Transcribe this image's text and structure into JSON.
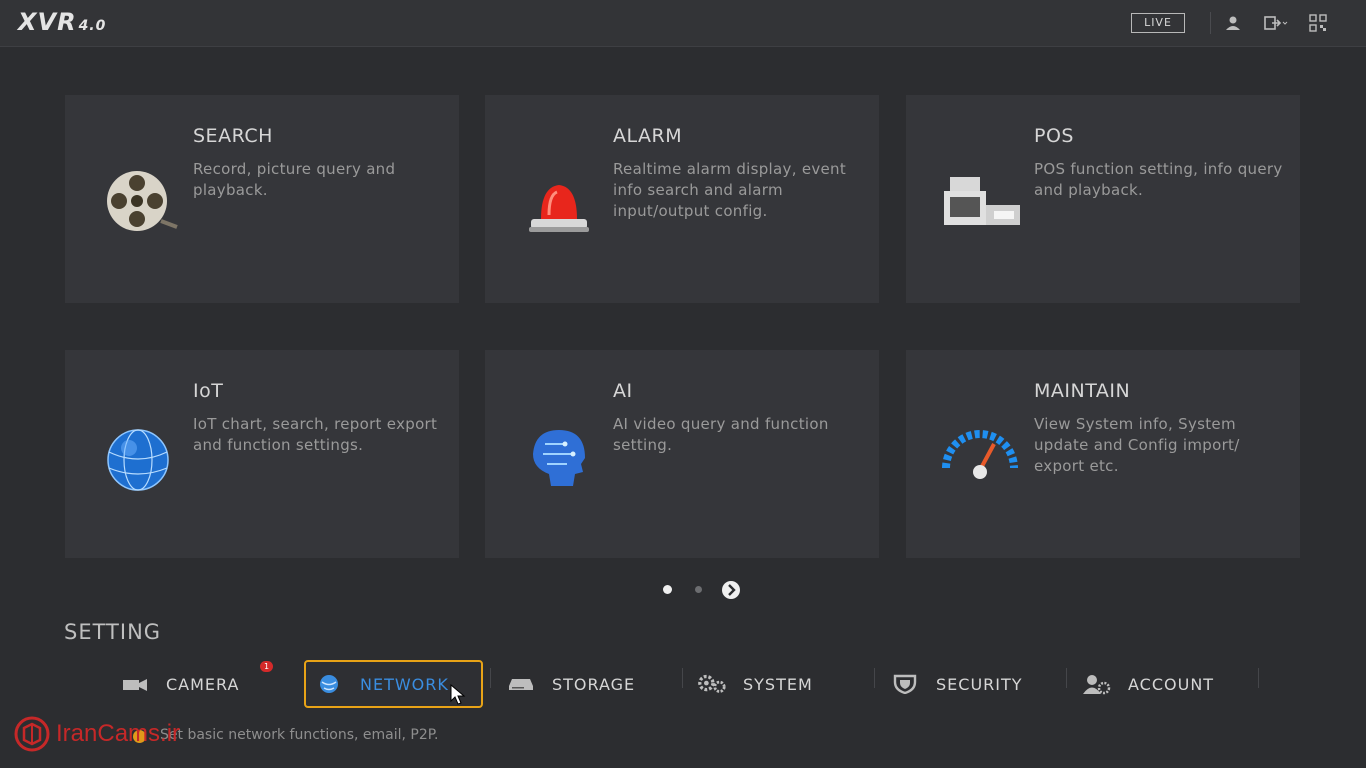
{
  "header": {
    "logo": "XVR",
    "version": "4.0",
    "live_label": "LIVE",
    "icons": [
      "user-icon",
      "logout-icon",
      "qr-code-icon"
    ]
  },
  "cards": [
    {
      "title": "SEARCH",
      "desc": "Record, picture query and playback.",
      "icon": "film-reel-icon"
    },
    {
      "title": "ALARM",
      "desc": "Realtime alarm display, event info search and alarm input/output config.",
      "icon": "alarm-light-icon"
    },
    {
      "title": "POS",
      "desc": "POS function setting, info query and playback.",
      "icon": "cash-register-icon"
    },
    {
      "title": "IoT",
      "desc": "IoT chart, search, report export and function settings.",
      "icon": "globe-icon"
    },
    {
      "title": "AI",
      "desc": "AI video query and function setting.",
      "icon": "ai-head-icon"
    },
    {
      "title": "MAINTAIN",
      "desc": "View System info, System update and Config import/ export etc.",
      "icon": "gauge-icon"
    }
  ],
  "pager": {
    "current": 1,
    "total": 2
  },
  "setting": {
    "title": "SETTING",
    "items": [
      {
        "label": "CAMERA",
        "icon": "camera-icon",
        "badge": "1"
      },
      {
        "label": "NETWORK",
        "icon": "network-globe-icon",
        "active": true
      },
      {
        "label": "STORAGE",
        "icon": "hdd-icon"
      },
      {
        "label": "SYSTEM",
        "icon": "gears-icon"
      },
      {
        "label": "SECURITY",
        "icon": "shield-icon"
      },
      {
        "label": "ACCOUNT",
        "icon": "account-icon"
      }
    ],
    "hint": "Set basic network functions, email, P2P."
  },
  "watermark": "IranCams.ir",
  "colors": {
    "accent": "#3a8de0",
    "highlight": "#e8a317",
    "badge": "#d42a2a",
    "background": "#2c2d30"
  }
}
